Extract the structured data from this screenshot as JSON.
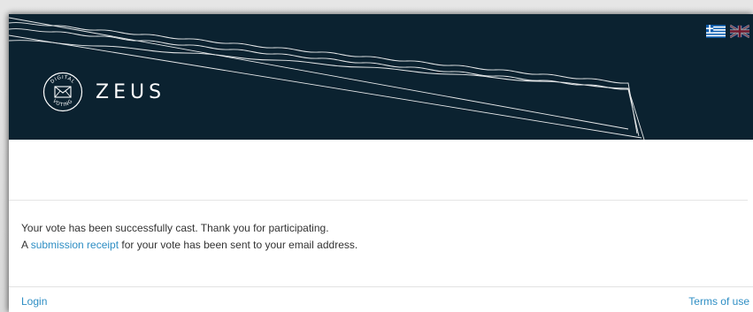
{
  "header": {
    "logo_text": "ZEUS",
    "logo_badge_top": "DIGITAL",
    "logo_badge_bottom": "VOTING",
    "languages": [
      "Greek",
      "English"
    ]
  },
  "message": {
    "line1": "Your vote has been successfully cast. Thank you for participating.",
    "line2_prefix": "A ",
    "line2_link": "submission receipt",
    "line2_suffix": " for your vote has been sent to your email address."
  },
  "footer": {
    "login_label": "Login",
    "terms_label": "Terms of use"
  },
  "colors": {
    "header_bg": "#0b2230",
    "link": "#2e8ec4",
    "text": "#333333"
  }
}
